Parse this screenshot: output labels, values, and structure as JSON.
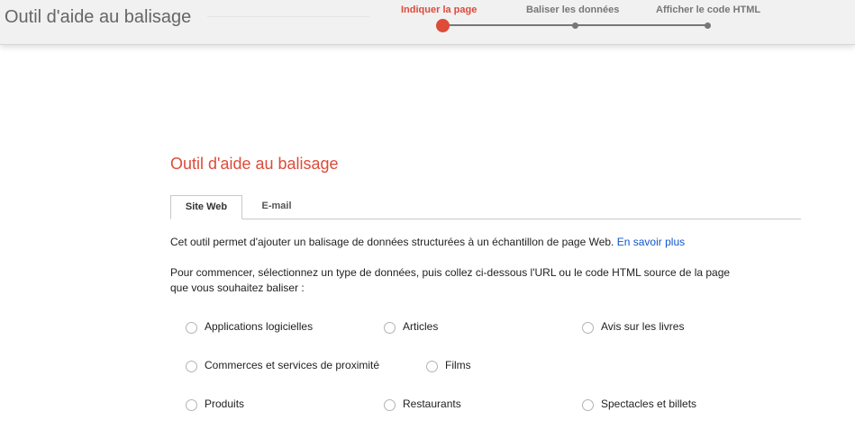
{
  "header": {
    "app_title": "Outil d'aide au balisage",
    "steps": [
      {
        "label": "Indiquer la page",
        "active": true
      },
      {
        "label": "Baliser les données",
        "active": false
      },
      {
        "label": "Afficher le code HTML",
        "active": false
      }
    ]
  },
  "main": {
    "title": "Outil d'aide au balisage",
    "tabs": [
      {
        "label": "Site Web",
        "active": true
      },
      {
        "label": "E-mail",
        "active": false
      }
    ],
    "intro_text": "Cet outil permet d'ajouter un balisage de données structurées à un échantillon de page Web.",
    "learn_more_link": "En savoir plus",
    "instruction_line1": "Pour commencer, sélectionnez un type de données, puis collez ci-dessous l'URL ou le code HTML source de la page",
    "instruction_line2": "que vous souhaitez baliser :",
    "data_types": [
      "Applications logicielles",
      "Articles",
      "Avis sur les livres",
      "Commerces et services de proximité",
      "Films",
      "Produits",
      "Restaurants",
      "Spectacles et billets"
    ]
  },
  "colors": {
    "accent": "#dd4b39",
    "link": "#1155cc",
    "header_bg": "#f1f1f1"
  }
}
